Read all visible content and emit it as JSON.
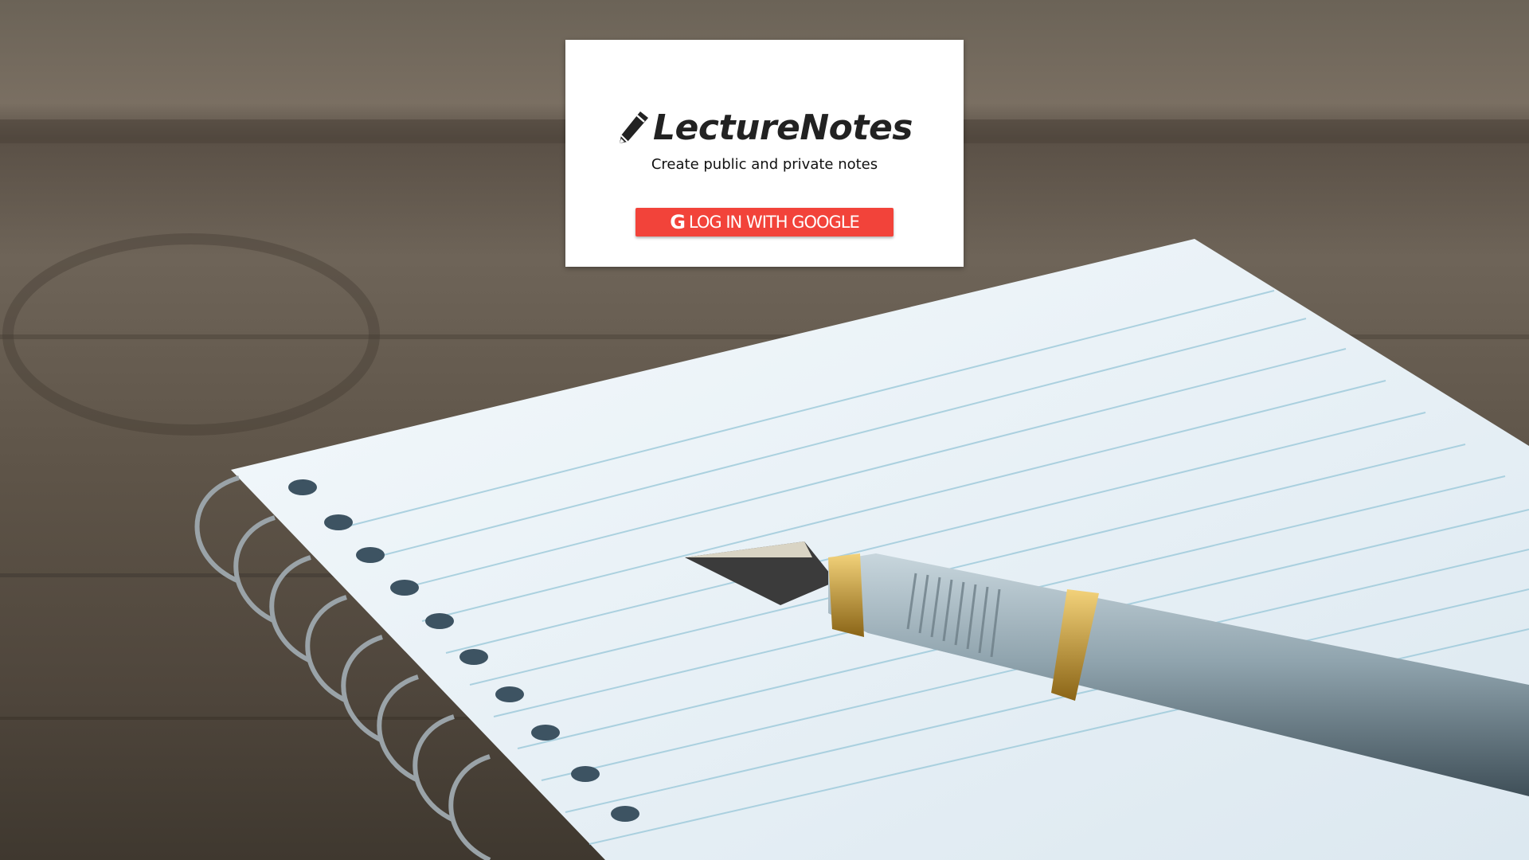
{
  "app": {
    "name": "LectureNotes",
    "tagline": "Create public and private notes"
  },
  "login": {
    "google_button_icon": "G",
    "google_button_label": "LOG IN WITH GOOGLE"
  },
  "icons": {
    "brand": "pencil-icon",
    "google": "google-g-icon"
  },
  "colors": {
    "google_button": "#f2433a",
    "card_background": "#ffffff",
    "title_text": "#222222"
  }
}
